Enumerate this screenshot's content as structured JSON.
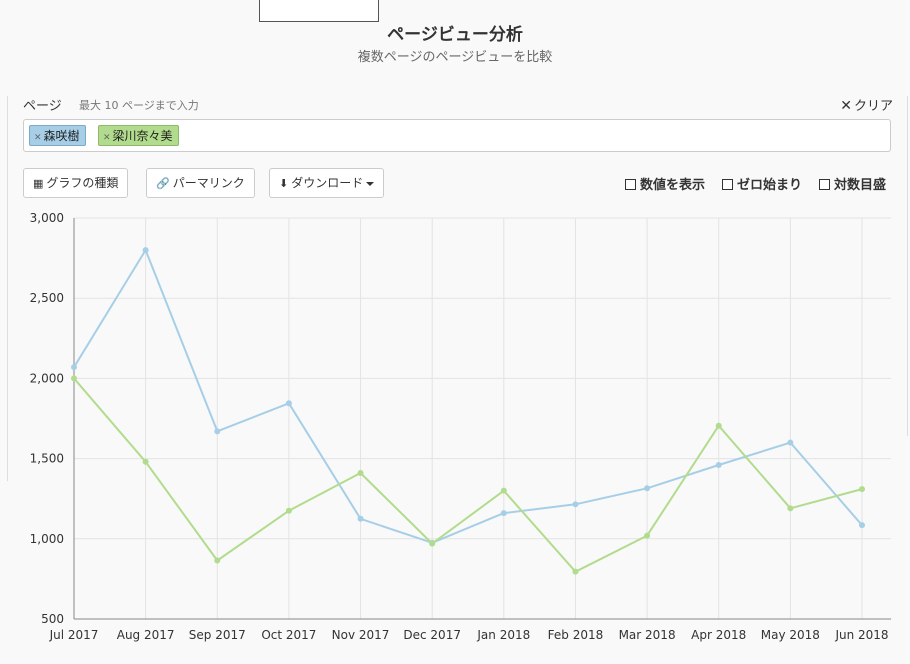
{
  "header": {
    "title": "ページビュー分析",
    "subtitle": "複数ページのページビューを比較"
  },
  "pages": {
    "label": "ページ",
    "hint": "最大 10 ページまで入力",
    "clear_label": "クリア",
    "tags": [
      {
        "name": "森咲樹",
        "color": "#a6cfe7"
      },
      {
        "name": "梁川奈々美",
        "color": "#b2dc8d"
      }
    ]
  },
  "toolbar": {
    "chart_type_label": "グラフの種類",
    "permalink_label": "パーマリンク",
    "download_label": "ダウンロード",
    "show_values_label": "数値を表示",
    "zero_start_label": "ゼロ始まり",
    "log_scale_label": "対数目盛"
  },
  "chart_data": {
    "type": "line",
    "categories": [
      "Jul 2017",
      "Aug 2017",
      "Sep 2017",
      "Oct 2017",
      "Nov 2017",
      "Dec 2017",
      "Jan 2018",
      "Feb 2018",
      "Mar 2018",
      "Apr 2018",
      "May 2018",
      "Jun 2018"
    ],
    "series": [
      {
        "name": "森咲樹",
        "color": "#a6cfe7",
        "values": [
          2070,
          2800,
          1670,
          1845,
          1125,
          975,
          1160,
          1215,
          1315,
          1460,
          1600,
          1085
        ]
      },
      {
        "name": "梁川奈々美",
        "color": "#b2dc8d",
        "values": [
          2000,
          1480,
          865,
          1175,
          1410,
          970,
          1300,
          795,
          1020,
          1705,
          1190,
          1310
        ]
      }
    ],
    "ylim": [
      500,
      3000
    ],
    "yticks": [
      "500",
      "1,000",
      "1,500",
      "2,000",
      "2,500",
      "3,000"
    ],
    "ytick_values": [
      500,
      1000,
      1500,
      2000,
      2500,
      3000
    ],
    "grid": true,
    "legend": "none"
  }
}
